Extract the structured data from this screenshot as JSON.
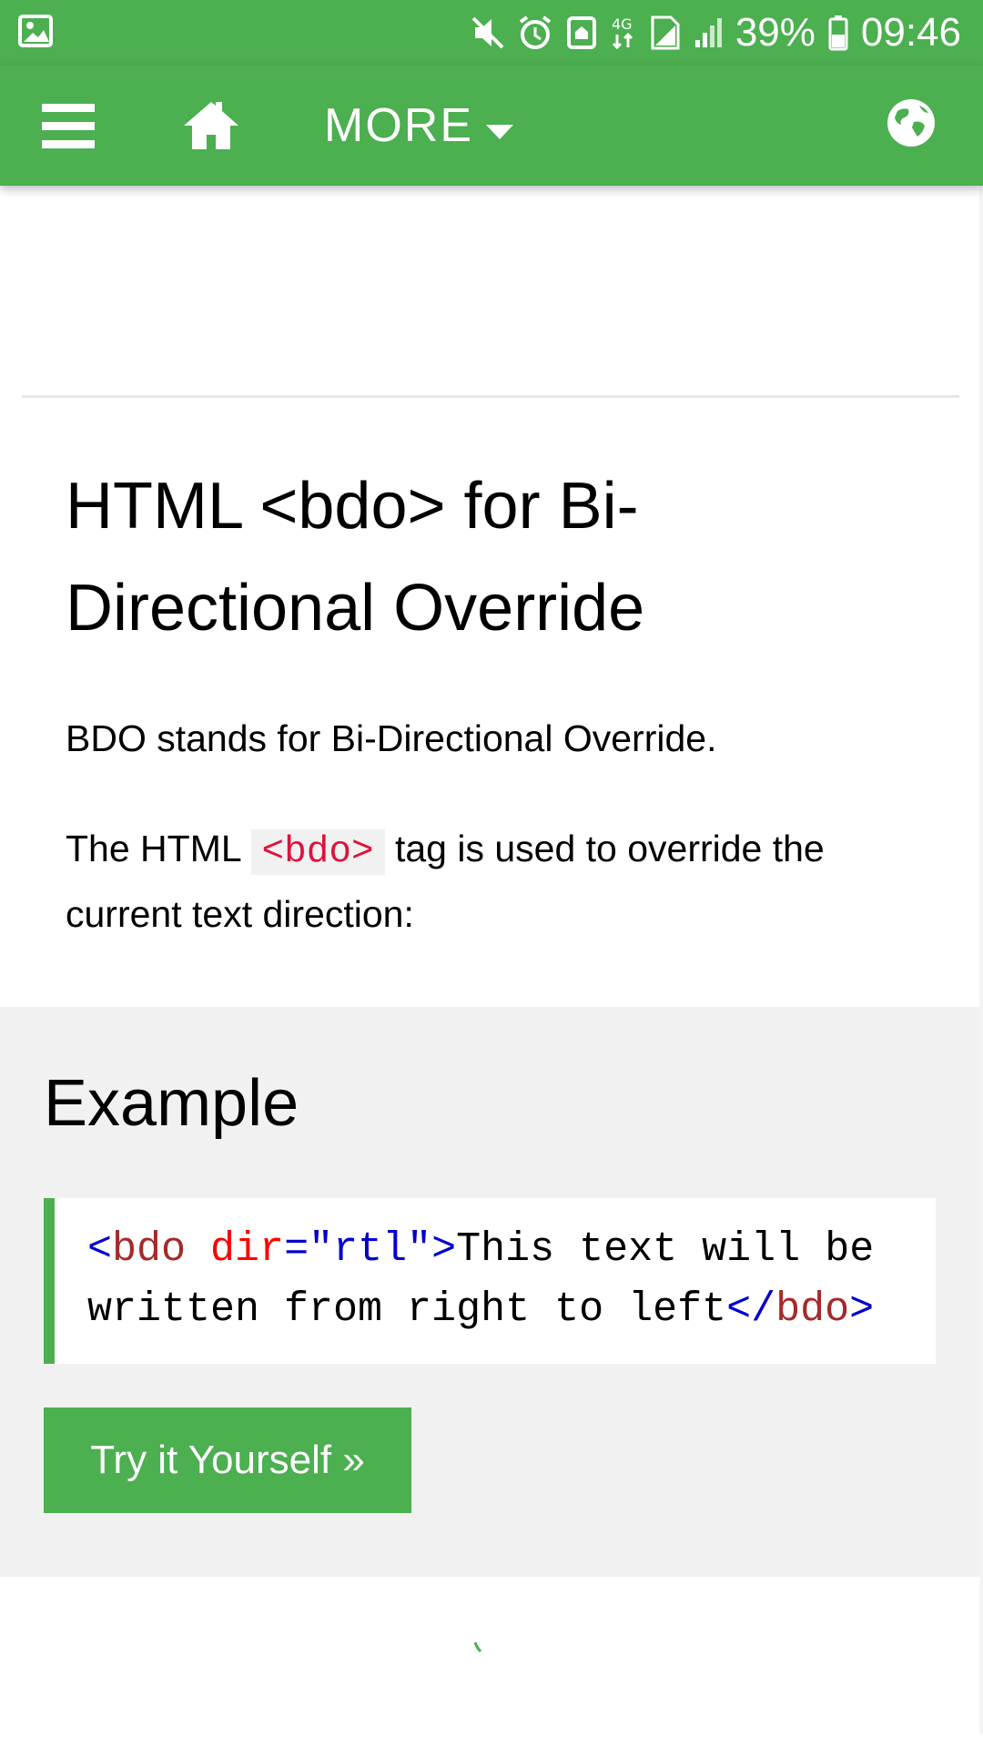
{
  "status_bar": {
    "battery": "39%",
    "time": "09:46",
    "network": "4G",
    "icons": [
      "gallery-icon",
      "mute-icon",
      "alarm-icon",
      "nfc-icon",
      "network-4g-icon",
      "sim-icon",
      "signal-icon",
      "battery-icon"
    ]
  },
  "navbar": {
    "more_label": "MORE",
    "icons": [
      "menu-icon",
      "home-icon",
      "caret-down-icon",
      "globe-icon"
    ],
    "accent": "#4caf50"
  },
  "article": {
    "title": "HTML <bdo> for Bi-Directional Override",
    "para1": "BDO stands for Bi-Directional Override.",
    "para2_before": "The HTML ",
    "para2_code": "<bdo>",
    "para2_after": " tag is used to override the current text direction:"
  },
  "example": {
    "heading": "Example",
    "code": {
      "open_lt": "<",
      "tag": "bdo",
      "attr": " dir",
      "eq": "=",
      "value": "\"rtl\"",
      "open_gt": ">",
      "text": "This text will be\nwritten from right to left",
      "close_lt": "</",
      "close_tag": "bdo",
      "close_gt": ">"
    },
    "button_label": "Try it Yourself »"
  }
}
